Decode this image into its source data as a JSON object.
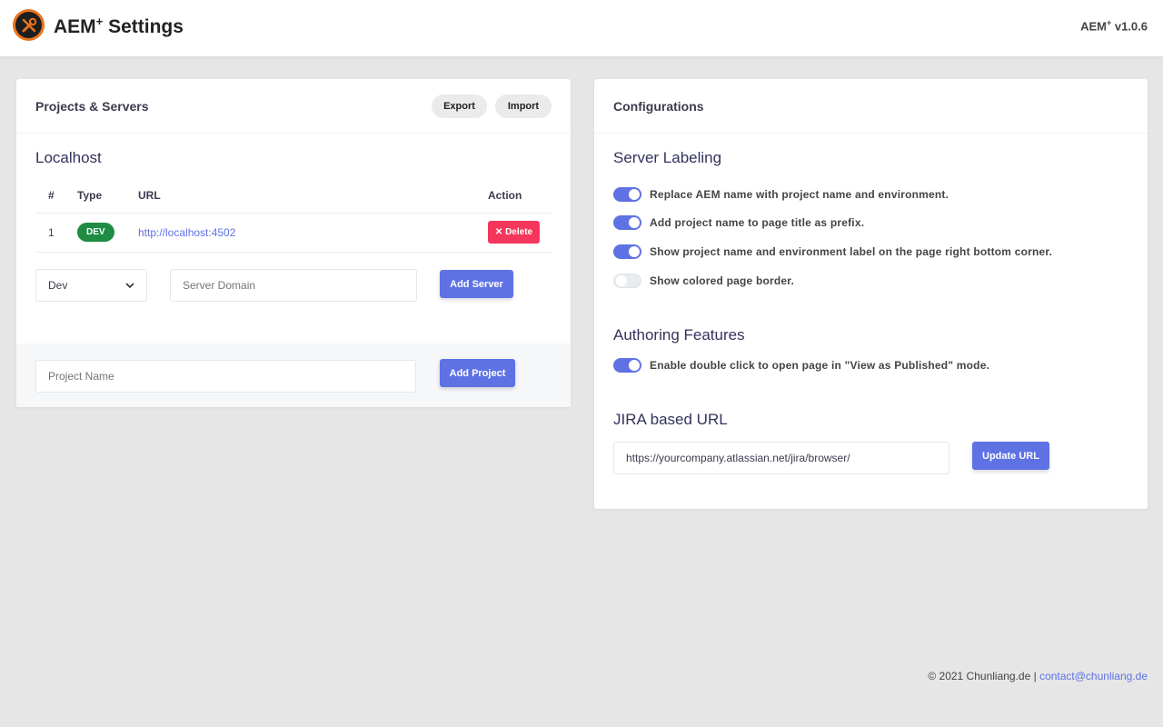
{
  "header": {
    "app_title": "AEM",
    "app_title_sup": "+",
    "app_title_suffix": " Settings",
    "version_prefix": "AEM",
    "version_sup": "+",
    "version_suffix": " v1.0.6",
    "logo_icon": "tools-icon"
  },
  "projects": {
    "title": "Projects & Servers",
    "export_label": "Export",
    "import_label": "Import",
    "project_name": "Localhost",
    "table": {
      "headers": [
        "#",
        "Type",
        "URL",
        "Action"
      ],
      "rows": [
        {
          "num": "1",
          "type": "DEV",
          "url": "http://localhost:4502",
          "action": "Delete",
          "action_icon": "✕"
        }
      ]
    },
    "env_select_value": "Dev",
    "server_domain_placeholder": "Server Domain",
    "add_server_label": "Add Server",
    "project_name_placeholder": "Project Name",
    "add_project_label": "Add Project"
  },
  "configurations": {
    "title": "Configurations",
    "server_labeling": {
      "title": "Server Labeling",
      "options": [
        {
          "label": "Replace AEM name with project name and environment.",
          "enabled": true
        },
        {
          "label": "Add project name to page title as prefix.",
          "enabled": true
        },
        {
          "label": "Show project name and environment label on the page right bottom corner.",
          "enabled": true
        },
        {
          "label": "Show colored page border.",
          "enabled": false
        }
      ]
    },
    "authoring": {
      "title": "Authoring Features",
      "options": [
        {
          "label": "Enable double click to open page in \"View as Published\" mode.",
          "enabled": true
        }
      ]
    },
    "jira": {
      "title": "JIRA based URL",
      "value": "https://yourcompany.atlassian.net/jira/browser/",
      "update_label": "Update URL"
    }
  },
  "footer": {
    "copyright": "© 2021 Chunliang.de | ",
    "email": "contact@chunliang.de"
  },
  "colors": {
    "accent": "#5e72e4",
    "danger": "#f5365c",
    "success": "#1e8c43",
    "logo_orange": "#e8741d"
  }
}
